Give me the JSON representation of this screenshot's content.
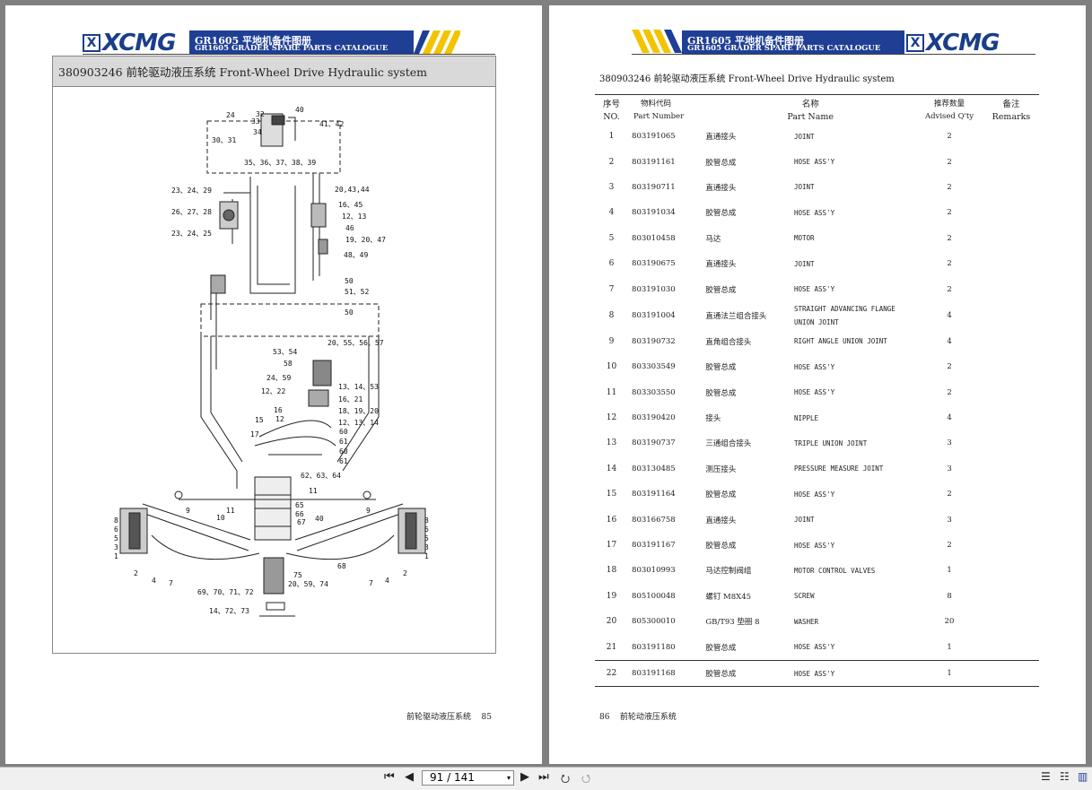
{
  "header": {
    "logo_text": "XCMG",
    "title_cn": "GR1605 平地机备件图册",
    "title_en": "GR1605 GRADER SPARE PARTS CATALOGUE"
  },
  "left_page": {
    "section_title": "380903246  前轮驱动液压系统  Front-Wheel Drive Hydraulic system",
    "footer_text": "前轮驱动液压系统",
    "page_number": "85",
    "diagram_labels": [
      "24",
      "32",
      "33",
      "30、31",
      "34",
      "40",
      "41、42",
      "35、36、37、38、39",
      "23、24、29",
      "26、27、28",
      "23、24、25",
      "20,43,44",
      "16、45",
      "12、13",
      "46",
      "19、20、47",
      "48、49",
      "50",
      "51、52",
      "50",
      "20、55、56、57",
      "53、54",
      "58",
      "24、59",
      "12、22",
      "13、14、53",
      "16、21",
      "18、19、20",
      "12、13、14",
      "16",
      "12",
      "15",
      "17",
      "60",
      "61",
      "60",
      "61",
      "62、63、64",
      "11",
      "11",
      "8",
      "6",
      "5",
      "3",
      "1",
      "9",
      "10",
      "2",
      "4",
      "7",
      "65",
      "66",
      "67",
      "40",
      "68",
      "75",
      "20、59、74",
      "69、70、71、72",
      "14、72、73",
      "9",
      "8",
      "6",
      "5",
      "3",
      "1",
      "2",
      "4",
      "7"
    ]
  },
  "right_page": {
    "section_title": "380903246  前轮驱动液压系统  Front-Wheel Drive Hydraulic system",
    "columns": {
      "no_cn": "序号",
      "no_en": "NO.",
      "pn_cn": "物料代码",
      "pn_en": "Part Number",
      "name_cn": "名称",
      "name_en": "Part Name",
      "qty_cn": "推荐数量",
      "qty_en": "Advised Q'ty",
      "rm_cn": "备注",
      "rm_en": "Remarks"
    },
    "rows": [
      {
        "no": "1",
        "pn": "803191065",
        "cn": "直通接头",
        "en": "JOINT",
        "qty": "2"
      },
      {
        "no": "2",
        "pn": "803191161",
        "cn": "胶管总成",
        "en": "HOSE ASS'Y",
        "qty": "2"
      },
      {
        "no": "3",
        "pn": "803190711",
        "cn": "直通接头",
        "en": "JOINT",
        "qty": "2"
      },
      {
        "no": "4",
        "pn": "803191034",
        "cn": "胶管总成",
        "en": "HOSE ASS'Y",
        "qty": "2"
      },
      {
        "no": "5",
        "pn": "803010458",
        "cn": "马达",
        "en": "MOTOR",
        "qty": "2"
      },
      {
        "no": "6",
        "pn": "803190675",
        "cn": "直通接头",
        "en": "JOINT",
        "qty": "2"
      },
      {
        "no": "7",
        "pn": "803191030",
        "cn": "胶管总成",
        "en": "HOSE ASS'Y",
        "qty": "2"
      },
      {
        "no": "8",
        "pn": "803191004",
        "cn": "直通法兰组合接头",
        "en": "STRAIGHT ADVANCING FLANGE UNION JOINT",
        "qty": "4"
      },
      {
        "no": "9",
        "pn": "803190732",
        "cn": "直角组合接头",
        "en": "RIGHT ANGLE UNION JOINT",
        "qty": "4"
      },
      {
        "no": "10",
        "pn": "803303549",
        "cn": "胶管总成",
        "en": "HOSE ASS'Y",
        "qty": "2"
      },
      {
        "no": "11",
        "pn": "803303550",
        "cn": "胶管总成",
        "en": "HOSE ASS'Y",
        "qty": "2"
      },
      {
        "no": "12",
        "pn": "803190420",
        "cn": "接头",
        "en": "NIPPLE",
        "qty": "4"
      },
      {
        "no": "13",
        "pn": "803190737",
        "cn": "三通组合接头",
        "en": "TRIPLE UNION JOINT",
        "qty": "3"
      },
      {
        "no": "14",
        "pn": "803130485",
        "cn": "测压接头",
        "en": "PRESSURE MEASURE JOINT",
        "qty": "3"
      },
      {
        "no": "15",
        "pn": "803191164",
        "cn": "胶管总成",
        "en": "HOSE ASS'Y",
        "qty": "2"
      },
      {
        "no": "16",
        "pn": "803166758",
        "cn": "直通接头",
        "en": "JOINT",
        "qty": "3"
      },
      {
        "no": "17",
        "pn": "803191167",
        "cn": "胶管总成",
        "en": "HOSE ASS'Y",
        "qty": "2"
      },
      {
        "no": "18",
        "pn": "803010993",
        "cn": "马达控制阀组",
        "en": "MOTOR CONTROL VALVES",
        "qty": "1"
      },
      {
        "no": "19",
        "pn": "805100048",
        "cn": "螺钉 M8X45",
        "en": "SCREW",
        "qty": "8"
      },
      {
        "no": "20",
        "pn": "805300010",
        "cn": "GB/T93  垫圈 8",
        "en": "WASHER",
        "qty": "20"
      },
      {
        "no": "21",
        "pn": "803191180",
        "cn": "胶管总成",
        "en": "HOSE ASS'Y",
        "qty": "1"
      },
      {
        "no": "22",
        "pn": "803191168",
        "cn": "胶管总成",
        "en": "HOSE ASS'Y",
        "qty": "1"
      }
    ],
    "footer_page": "86",
    "footer_text": "前轮动液压系统"
  },
  "toolbar": {
    "page_indicator": "91 / 141",
    "first_icon": "first-page-icon",
    "prev_icon": "prev-page-icon",
    "next_icon": "next-page-icon",
    "last_icon": "last-page-icon"
  }
}
